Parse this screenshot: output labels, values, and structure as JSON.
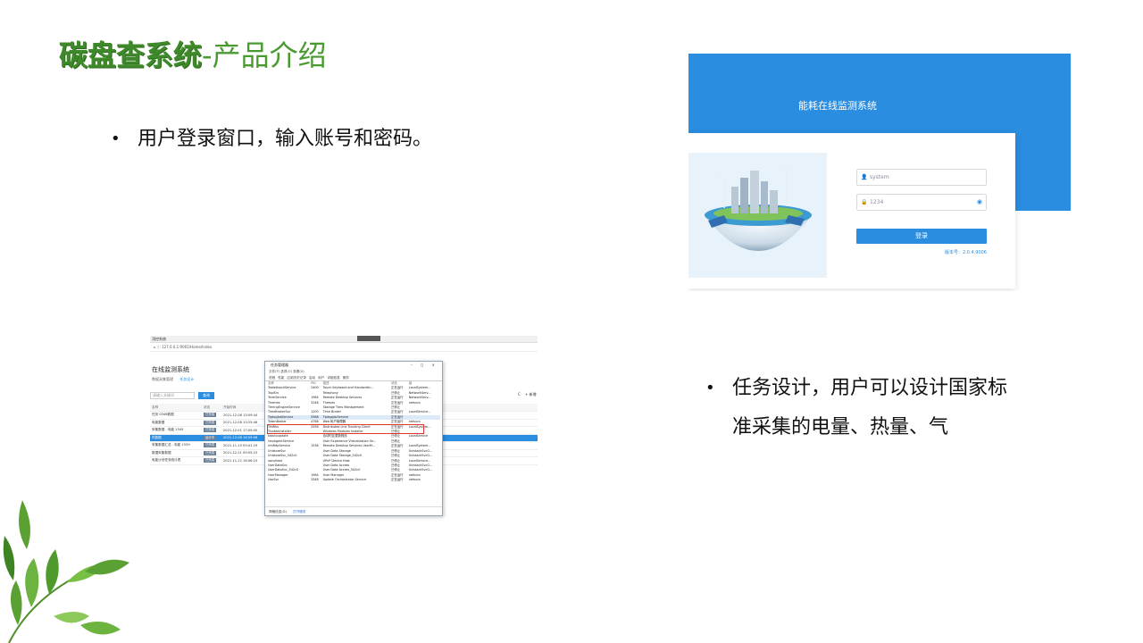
{
  "title": {
    "strong": "碳盘查系统",
    "light": "-产品介绍"
  },
  "bullets": {
    "login": "用户登录窗口，输入账号和密码。",
    "task": "任务设计，用户可以设计国家标准采集的电量、热量、气"
  },
  "bullet_glyph": "•",
  "login_shot": {
    "system_title": "能耗在线监测系统",
    "username": "system",
    "password": "1234",
    "login_button": "登录",
    "version": "版本号：2.0.4.9006",
    "colors": {
      "primary": "#2a8de0"
    }
  },
  "browser_shot": {
    "tab": "顶控系统",
    "url": "127.0.0.1:9001/Home/Index",
    "app_title": "在线监测系统",
    "subtabs": [
      "数据采集管理",
      "任务设计"
    ],
    "search_placeholder": "请输入关键词",
    "search_button": "查询",
    "right_buttons": [
      "C",
      "+ 新增"
    ],
    "columns": [
      "名称",
      "状态",
      "开始时间"
    ],
    "rows": [
      {
        "name": "任务 0346数据",
        "status": "已完成",
        "time": "2021-12-08 13:09:44",
        "selected": false
      },
      {
        "name": "电能数据",
        "status": "已完成",
        "time": "2021-12-08 13:25:48",
        "selected": false
      },
      {
        "name": "采集数据 - 电能 1549",
        "status": "已完成",
        "time": "2021-12-01 17:09:00",
        "selected": false
      },
      {
        "name": "热数据",
        "status": "运行中",
        "time": "2021-12-08 16:59:06",
        "selected": true
      },
      {
        "name": "采集数据汇总 - 电能 1539",
        "status": "已完成",
        "time": "2021-11-19 09:41:29",
        "selected": false
      },
      {
        "name": "数据采集数据",
        "status": "已完成",
        "time": "2021-12-21 09:55:23",
        "selected": false
      },
      {
        "name": "电能计划任务统计表",
        "status": "已完成",
        "time": "2021-11-12 16:06:23",
        "selected": false
      }
    ]
  },
  "task_manager": {
    "title": "任务管理器",
    "controls": "– ◻ ×",
    "menu": "文件(F)  选项(O)  查看(V)",
    "tabs": [
      "进程",
      "性能",
      "应用历史记录",
      "启动",
      "用户",
      "详细信息",
      "服务"
    ],
    "columns": [
      "名称",
      "PID",
      "描述",
      "状态",
      "组"
    ],
    "rows": [
      {
        "name": "TabletInputService",
        "pid": "2400",
        "desc": "Touch Keyboard and Handwritin...",
        "status": "正在运行",
        "group": "LocalSystem..."
      },
      {
        "name": "TapiSrv",
        "pid": "",
        "desc": "Telephony",
        "status": "已停止",
        "group": "NetworkServ..."
      },
      {
        "name": "TermService",
        "pid": "1984",
        "desc": "Remote Desktop Services",
        "status": "正在运行",
        "group": "NetworkServ..."
      },
      {
        "name": "Themes",
        "pid": "3148",
        "desc": "Themes",
        "status": "正在运行",
        "group": "netsvcs"
      },
      {
        "name": "TieringEngineService",
        "pid": "",
        "desc": "Storage Tiers Management",
        "status": "已停止",
        "group": ""
      },
      {
        "name": "TimeBrokerSvc",
        "pid": "1200",
        "desc": "Time Broker",
        "status": "正在运行",
        "group": "LocalService..."
      },
      {
        "name": "TiptopJobService",
        "pid": "5588",
        "desc": "TiptopJobService",
        "status": "正在运行",
        "group": "",
        "highlight": true
      },
      {
        "name": "TokenBroker",
        "pid": "4768",
        "desc": "Web 帐户管理器",
        "status": "正在运行",
        "group": "netsvcs"
      },
      {
        "name": "TrkWks",
        "pid": "2556",
        "desc": "Distributed Link Tracking Client",
        "status": "正在运行",
        "group": "LocalSystem..."
      },
      {
        "name": "TrustedInstaller",
        "pid": "",
        "desc": "Windows Modules Installer",
        "status": "已停止",
        "group": ""
      },
      {
        "name": "tzautoupdate",
        "pid": "",
        "desc": "自动时区更新程序",
        "status": "已停止",
        "group": "LocalService"
      },
      {
        "name": "UevAgentService",
        "pid": "",
        "desc": "User Experience Virtualization Se...",
        "status": "已停止",
        "group": ""
      },
      {
        "name": "UmRdpService",
        "pid": "1536",
        "desc": "Remote Desktop Services UserM...",
        "status": "正在运行",
        "group": "LocalSystem..."
      },
      {
        "name": "UnistoreSvc",
        "pid": "",
        "desc": "User Data Storage",
        "status": "已停止",
        "group": "UnistackSvcG..."
      },
      {
        "name": "UnistoreSvc_542c0",
        "pid": "",
        "desc": "User Data Storage_542c0",
        "status": "已停止",
        "group": "UnistackSvcG..."
      },
      {
        "name": "upnphost",
        "pid": "",
        "desc": "UPnP Device Host",
        "status": "已停止",
        "group": "LocalService..."
      },
      {
        "name": "UserDataSvc",
        "pid": "",
        "desc": "User Data Access",
        "status": "已停止",
        "group": "UnistackSvcG..."
      },
      {
        "name": "UserDataSvc_542c0",
        "pid": "",
        "desc": "User Data Access_542c0",
        "status": "已停止",
        "group": "UnistackSvcG..."
      },
      {
        "name": "UserManager",
        "pid": "1964",
        "desc": "User Manager",
        "status": "正在运行",
        "group": "netsvcs"
      },
      {
        "name": "UsoSvc",
        "pid": "3348",
        "desc": "Update Orchestrator Service",
        "status": "正在运行",
        "group": "netsvcs"
      }
    ],
    "footer": "简略信息(D)",
    "footer_link": "打开服务"
  }
}
